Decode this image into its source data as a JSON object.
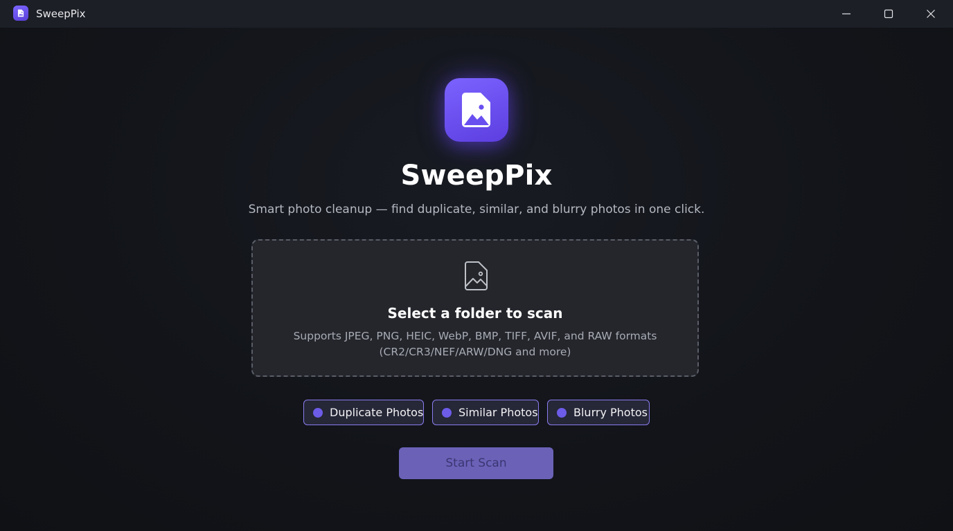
{
  "window": {
    "title": "SweepPix",
    "controls": {
      "minimize_icon": "minimize-icon",
      "maximize_icon": "maximize-icon",
      "close_icon": "close-icon"
    }
  },
  "hero": {
    "icon": "image-file-icon",
    "title": "SweepPix",
    "subtitle": "Smart photo cleanup — find duplicate, similar, and blurry photos in one click."
  },
  "dropzone": {
    "icon": "image-file-outline-icon",
    "title": "Select a folder to scan",
    "description": "Supports JPEG, PNG, HEIC, WebP, BMP, TIFF, AVIF, and RAW formats (CR2/CR3/NEF/ARW/DNG and more)"
  },
  "options": [
    {
      "label": "Duplicate Photos",
      "selected": true
    },
    {
      "label": "Similar Photos",
      "selected": true
    },
    {
      "label": "Blurry Photos",
      "selected": true
    }
  ],
  "actions": {
    "start_scan_label": "Start Scan",
    "start_scan_enabled": false
  },
  "colors": {
    "accent": "#6c5ce8",
    "accent_border": "#8c7cf0",
    "background": "#131519",
    "titlebar": "#1c1f26",
    "dropzone_bg": "#24262c",
    "start_button_disabled": "#6b62b8"
  }
}
